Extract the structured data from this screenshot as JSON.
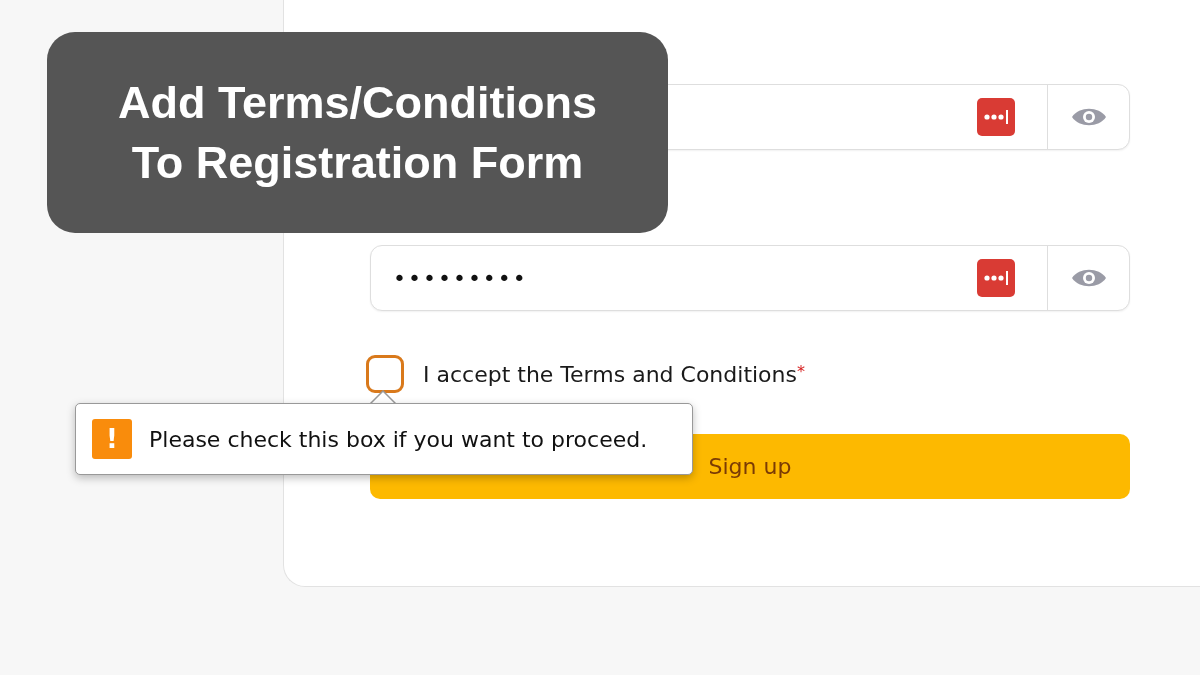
{
  "banner": {
    "lines": [
      "Add Terms/Conditions",
      "To Registration Form"
    ]
  },
  "fields": [
    {
      "kind": "password"
    },
    {
      "kind": "password",
      "value": "•••••••••"
    }
  ],
  "terms": {
    "label": "I accept the Terms and Conditions",
    "required_mark": "*",
    "checked": false,
    "invalid": true
  },
  "tooltip": {
    "icon": "!",
    "message": "Please check this box if you want to proceed."
  },
  "submit": {
    "label": "Sign up"
  }
}
